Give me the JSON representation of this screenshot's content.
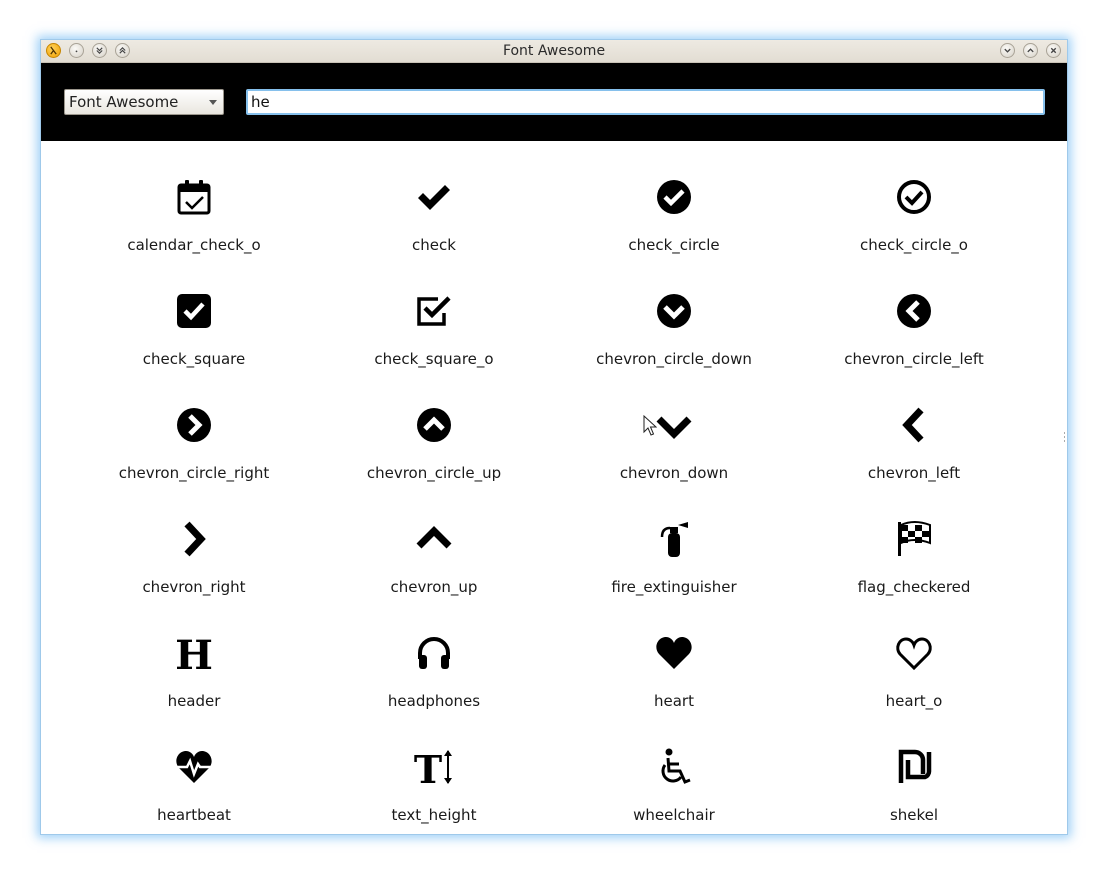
{
  "window": {
    "title": "Font Awesome"
  },
  "toolbar": {
    "font_select": {
      "value": "Font Awesome"
    },
    "search": {
      "value": "he"
    }
  },
  "icons": [
    {
      "label": "calendar_check_o",
      "icon": "calendar-check-o-icon"
    },
    {
      "label": "check",
      "icon": "check-icon"
    },
    {
      "label": "check_circle",
      "icon": "check-circle-icon"
    },
    {
      "label": "check_circle_o",
      "icon": "check-circle-o-icon"
    },
    {
      "label": "check_square",
      "icon": "check-square-icon"
    },
    {
      "label": "check_square_o",
      "icon": "check-square-o-icon"
    },
    {
      "label": "chevron_circle_down",
      "icon": "chevron-circle-down-icon"
    },
    {
      "label": "chevron_circle_left",
      "icon": "chevron-circle-left-icon"
    },
    {
      "label": "chevron_circle_right",
      "icon": "chevron-circle-right-icon"
    },
    {
      "label": "chevron_circle_up",
      "icon": "chevron-circle-up-icon"
    },
    {
      "label": "chevron_down",
      "icon": "chevron-down-icon"
    },
    {
      "label": "chevron_left",
      "icon": "chevron-left-icon"
    },
    {
      "label": "chevron_right",
      "icon": "chevron-right-icon"
    },
    {
      "label": "chevron_up",
      "icon": "chevron-up-icon"
    },
    {
      "label": "fire_extinguisher",
      "icon": "fire-extinguisher-icon"
    },
    {
      "label": "flag_checkered",
      "icon": "flag-checkered-icon"
    },
    {
      "label": "header",
      "icon": "header-icon"
    },
    {
      "label": "headphones",
      "icon": "headphones-icon"
    },
    {
      "label": "heart",
      "icon": "heart-icon"
    },
    {
      "label": "heart_o",
      "icon": "heart-o-icon"
    },
    {
      "label": "heartbeat",
      "icon": "heartbeat-icon"
    },
    {
      "label": "text_height",
      "icon": "text-height-icon"
    },
    {
      "label": "wheelchair",
      "icon": "wheelchair-icon"
    },
    {
      "label": "shekel",
      "icon": "shekel-icon"
    }
  ],
  "colors": {
    "toolbar_bg": "#000000",
    "titlebar_bg": "#e6e1d8",
    "accent_focus": "#86c0ec",
    "icon_color": "#000000"
  }
}
